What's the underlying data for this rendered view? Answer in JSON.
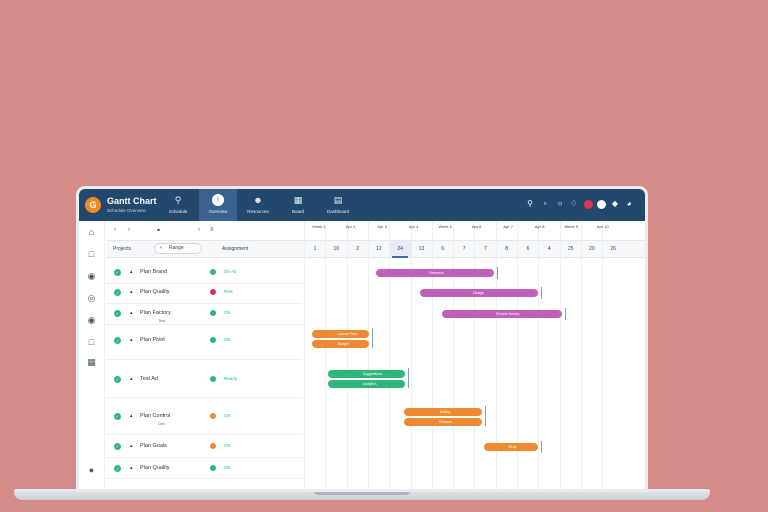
{
  "app": {
    "title": "Gantt Chart",
    "subtitle": "Schedule Overview",
    "logo": "G"
  },
  "nav": [
    {
      "label": "Schedule",
      "icon": "search-icon",
      "active": false
    },
    {
      "label": "Overview",
      "icon": "info-icon",
      "active": true
    },
    {
      "label": "Resources",
      "icon": "user-icon",
      "active": false
    },
    {
      "label": "Board",
      "icon": "folder-icon",
      "active": false
    },
    {
      "label": "Dashboard",
      "icon": "chart-icon",
      "active": false
    }
  ],
  "toolbar": {
    "colors": {
      "accent": "#23486e",
      "red": "#e0334f",
      "white": "#ffffff",
      "blue": "#3d8fd1"
    }
  },
  "gantt": {
    "zoom_label": "Range",
    "filter_label": "Projects",
    "column_label": "Assignment",
    "week_labels": [
      "Week 1",
      "Apr 2",
      "Apr 3",
      "Apr 4",
      "Week 5",
      "Apr 6",
      "Apr 7",
      "Apr 8",
      "Week 9",
      "Apr 10"
    ],
    "days": [
      "1",
      "10",
      "2",
      "12",
      "24",
      "13",
      "6",
      "7",
      "7",
      "8",
      "6",
      "4",
      "25",
      "20",
      "26"
    ],
    "tasks": [
      {
        "name": "Plan Brand",
        "status": "On Air",
        "state": "done",
        "bar": {
          "label": "Research",
          "color": "#c160b8"
        }
      },
      {
        "name": "Plan Quality",
        "status": "Risk",
        "state": "risk",
        "bar": {
          "label": "Design",
          "color": "#c160b8"
        }
      },
      {
        "name": "Plan Factory",
        "sub": "Test",
        "status": "OK",
        "state": "done",
        "bar": {
          "label": "Review Survey",
          "color": "#c160b8"
        }
      },
      {
        "name": "Plan Pivot",
        "status": "OK",
        "state": "done",
        "bars": [
          {
            "label": "Launch Plan",
            "color": "#f08a32"
          },
          {
            "label": "Budget",
            "color": "#f08a32"
          }
        ]
      },
      {
        "name": "Test Ad",
        "status": "Ready",
        "state": "done",
        "bars": [
          {
            "label": "Suggestions",
            "color": "#2fb67b"
          },
          {
            "label": "Analytics",
            "color": "#2fb67b"
          }
        ]
      },
      {
        "name": "Plan Control",
        "sub": "Dev",
        "status": "OK",
        "state": "warn",
        "bars": [
          {
            "label": "Testing",
            "color": "#f08a32"
          },
          {
            "label": "Release",
            "color": "#f08a32"
          }
        ]
      },
      {
        "name": "Plan Goals",
        "status": "OK",
        "state": "warn",
        "bar": {
          "label": "Wrap",
          "color": "#f08a32"
        }
      },
      {
        "name": "Plan Quality",
        "status": "OK",
        "state": "done",
        "bar": {
          "label": "",
          "color": ""
        }
      }
    ]
  }
}
